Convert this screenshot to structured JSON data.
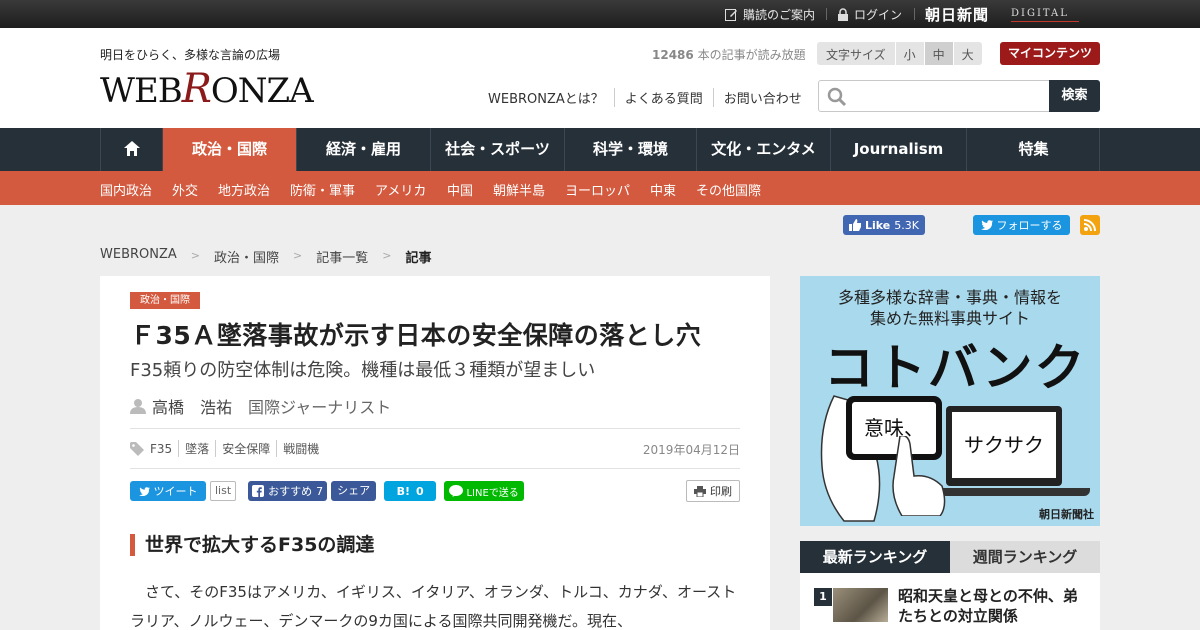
{
  "topbar": {
    "guide": "購読のご案内",
    "login": "ログイン",
    "brand": "朝日新聞",
    "brand_sub": "DIGITAL"
  },
  "header": {
    "tagline": "明日をひらく、多様な言論の広場",
    "logo_pre": "WEB",
    "logo_r": "R",
    "logo_post": "ONZA",
    "read_count": "12486",
    "read_count_suffix": " 本の記事が読み放題",
    "font_size_label": "文字サイズ",
    "font_size_options": [
      "小",
      "中",
      "大"
    ],
    "font_size_selected": "中",
    "my_content": "マイコンテンツ",
    "links": [
      "WEBRONZAとは？",
      "よくある質問",
      "お問い合わせ"
    ],
    "search_placeholder": "",
    "search_button": "検索"
  },
  "main_nav": [
    "政治・国際",
    "経済・雇用",
    "社会・スポーツ",
    "科学・環境",
    "文化・エンタメ",
    "Journalism",
    "特集"
  ],
  "main_nav_active": "政治・国際",
  "sub_nav": [
    "国内政治",
    "外交",
    "地方政治",
    "防衛・軍事",
    "アメリカ",
    "中国",
    "朝鮮半島",
    "ヨーロッパ",
    "中東",
    "その他国際"
  ],
  "social": {
    "fb_like": "Like",
    "fb_like_count": "5.3K",
    "twitter_follow": "フォローする"
  },
  "breadcrumb": [
    "WEBRONZA",
    "政治・国際",
    "記事一覧",
    "記事"
  ],
  "article": {
    "category": "政治・国際",
    "title": "Ｆ35Ａ墜落事故が示す日本の安全保障の落とし穴",
    "subtitle": "F35頼りの防空体制は危険。機種は最低３種類が望ましい",
    "author_name": "高橋　浩祐",
    "author_role": "国際ジャーナリスト",
    "tags": [
      "F35",
      "墜落",
      "安全保障",
      "戦闘機"
    ],
    "date": "2019年04月12日",
    "share": {
      "tweet": "ツイート",
      "list": "list",
      "fb_recommend": "おすすめ",
      "fb_count": "7",
      "fb_share": "シェア",
      "hatena": "B!",
      "hatena_count": "0",
      "line": "LINEで送る",
      "print": "印刷"
    },
    "section_heading": "世界で拡大するF35の調達",
    "body": "　さて、そのF35はアメリカ、イギリス、イタリア、オランダ、トルコ、カナダ、オーストラリア、ノルウェー、デンマークの9カ国による国際共同開発機だ。現在、"
  },
  "ad": {
    "line1": "多種多様な辞書・事典・情報を",
    "line2": "集めた無料事典サイト",
    "big": "コトバンク",
    "phone_text": "意味、",
    "laptop_text": "サクサク",
    "credit": "朝日新聞社",
    "ad_bg": "#a9d9ec"
  },
  "ranking": {
    "tabs": [
      "最新ランキング",
      "週間ランキング"
    ],
    "active_tab": "最新ランキング",
    "items": [
      {
        "rank": "1",
        "title": "昭和天皇と母との不仲、弟たちとの対立関係"
      }
    ]
  },
  "colors": {
    "accent": "#d35a3f",
    "nav_dark": "#263039",
    "brand_red": "#9c1a1a"
  }
}
